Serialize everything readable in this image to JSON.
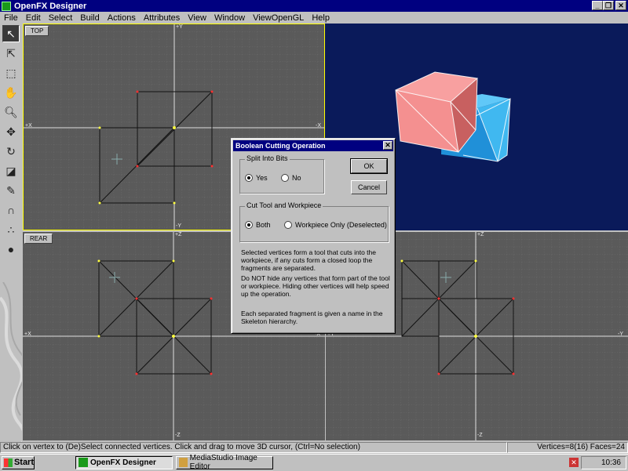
{
  "window": {
    "title": "OpenFX Designer",
    "controls": {
      "minimize": "_",
      "maximize": "❐",
      "close": "✕"
    }
  },
  "menu": [
    "File",
    "Edit",
    "Select",
    "Build",
    "Actions",
    "Attributes",
    "View",
    "Window",
    "ViewOpenGL",
    "Help"
  ],
  "toolbar": {
    "tools": [
      "pointer-icon",
      "select-arrow-icon",
      "marquee-icon",
      "hand-pan-icon",
      "zoom-icon",
      "move-icon",
      "rotate-icon",
      "scale-icon",
      "pen-icon",
      "magnet-icon",
      "spheres-icon",
      "ball-icon"
    ]
  },
  "viewports": {
    "top": {
      "label": "TOP",
      "axis_pos": "+Y",
      "axis_neg": "-Y",
      "axis_h_neg": "+X",
      "axis_h_pos": "-X"
    },
    "rear": {
      "label": "REAR",
      "axis_pos": "+Z",
      "axis_neg": "-Z",
      "axis_h_neg": "+X",
      "axis_h_pos": "-X"
    },
    "side": {
      "axis_pos": "+Z",
      "axis_neg": "-Z",
      "axis_h_neg": "+Y",
      "axis_h_pos": "-Y"
    }
  },
  "dialog": {
    "title": "Boolean Cutting Operation",
    "close": "✕",
    "split_group": "Split Into Bits",
    "split_yes": "Yes",
    "split_no": "No",
    "ok": "OK",
    "cancel": "Cancel",
    "cut_group": "Cut Tool and Workpiece",
    "cut_both": "Both",
    "cut_workpiece": "Workpiece Only (Deselected)",
    "info1": "Selected vertices form a tool that cuts into the workpiece, if any cuts form a closed loop the fragments are separated.",
    "info2": "Do NOT hide any vertices that form part of the tool or workpiece. Hiding other vertices will help speed up the operation.",
    "info3": "Each separated fragment is given a name in the Skeleton hierarchy."
  },
  "status": {
    "message": "Click on vertex to (De)Select connected vertices. Click and drag to move 3D cursor, (Ctrl=No selection)",
    "counts": "Vertices=8(16) Faces=24"
  },
  "taskbar": {
    "start": "Start",
    "tasks": [
      "OpenFX Designer",
      "MediaStudio Image Editor"
    ],
    "clock": "10:36"
  },
  "colors": {
    "accent": "#000080",
    "viewport": "#5a5a5a",
    "preview_bg": "#0a1a5a",
    "cube_pink": "#f09090",
    "cube_blue": "#20a0e8"
  }
}
